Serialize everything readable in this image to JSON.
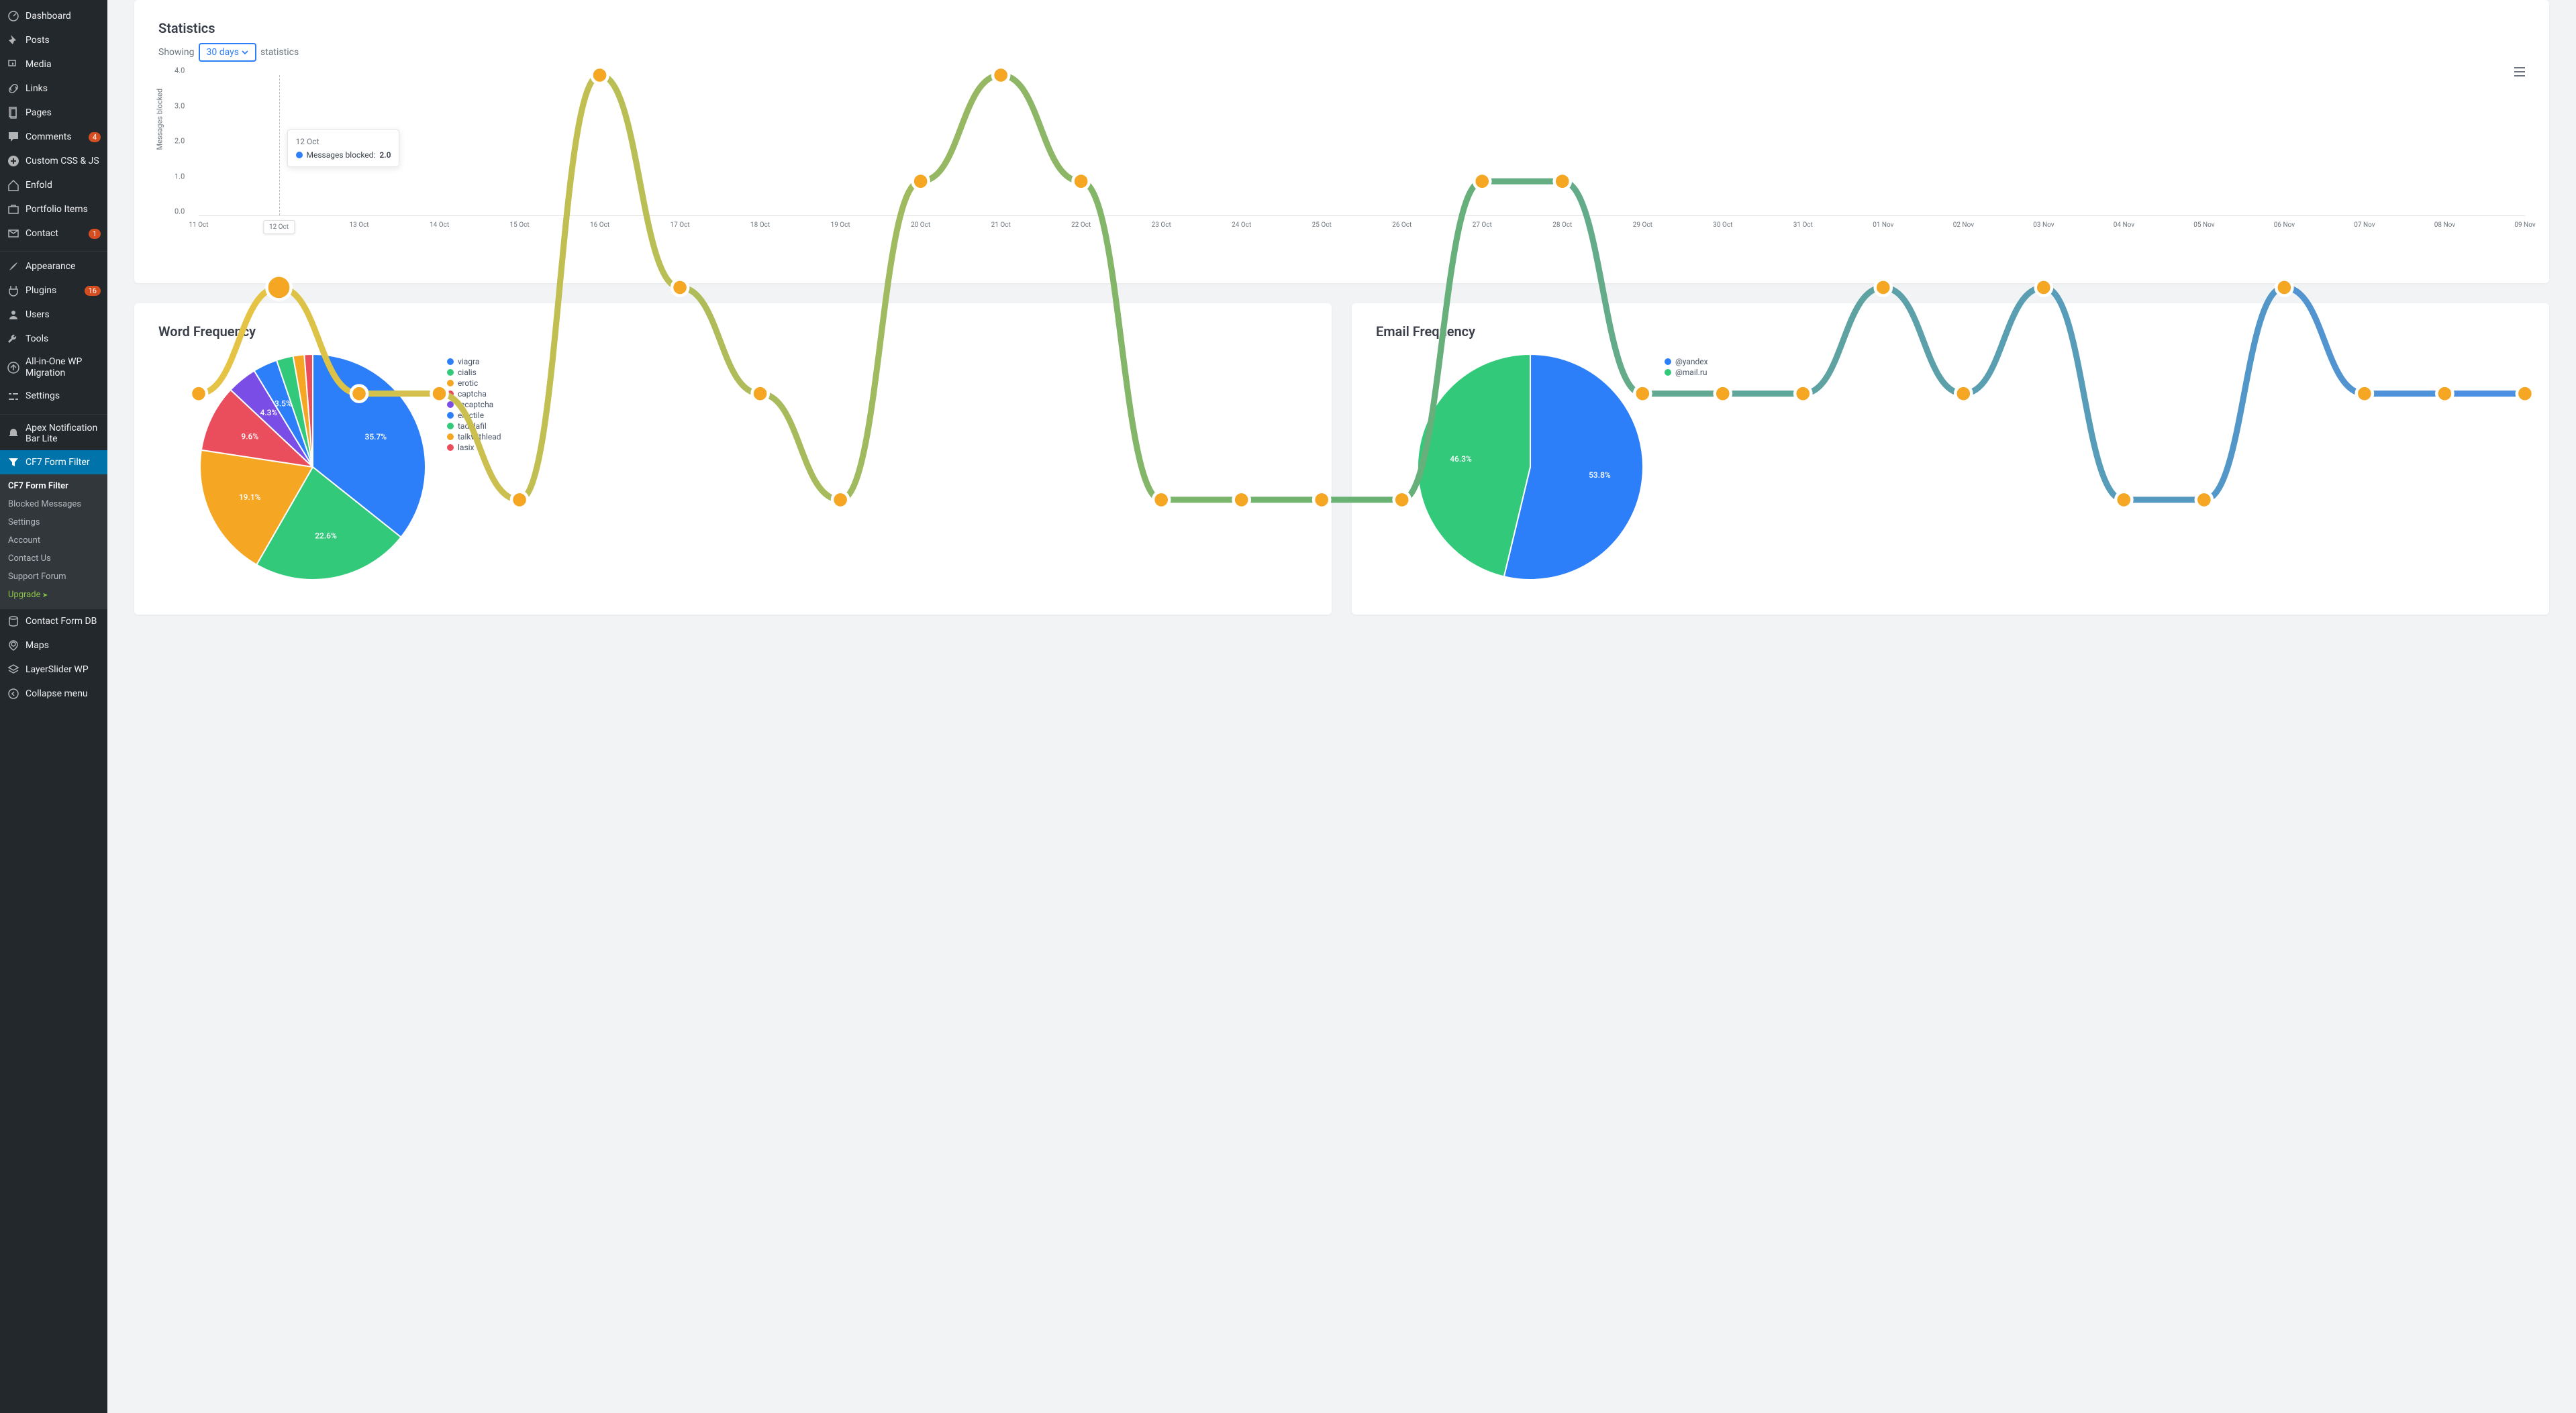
{
  "sidebar": {
    "items": [
      {
        "label": "Dashboard",
        "icon": "dashboard"
      },
      {
        "label": "Posts",
        "icon": "pin"
      },
      {
        "label": "Media",
        "icon": "media"
      },
      {
        "label": "Links",
        "icon": "link"
      },
      {
        "label": "Pages",
        "icon": "page"
      },
      {
        "label": "Comments",
        "icon": "comment",
        "badge": "4"
      },
      {
        "label": "Custom CSS & JS",
        "icon": "plus"
      },
      {
        "label": "Enfold",
        "icon": "home"
      },
      {
        "label": "Portfolio Items",
        "icon": "portfolio"
      },
      {
        "label": "Contact",
        "icon": "contact",
        "badge": "1"
      },
      {
        "sep": true
      },
      {
        "label": "Appearance",
        "icon": "brush"
      },
      {
        "label": "Plugins",
        "icon": "plugin",
        "badge": "16"
      },
      {
        "label": "Users",
        "icon": "user"
      },
      {
        "label": "Tools",
        "icon": "wrench"
      },
      {
        "label": "All-in-One WP Migration",
        "icon": "migrate"
      },
      {
        "label": "Settings",
        "icon": "settings"
      },
      {
        "sep": true
      },
      {
        "label": "Apex Notification Bar Lite",
        "icon": "bell"
      },
      {
        "label": "CF7 Form Filter",
        "icon": "filter",
        "active": true
      }
    ],
    "submenu": [
      {
        "label": "CF7 Form Filter",
        "current": true
      },
      {
        "label": "Blocked Messages"
      },
      {
        "label": "Settings"
      },
      {
        "label": "Account"
      },
      {
        "label": "Contact Us"
      },
      {
        "label": "Support Forum"
      },
      {
        "label": "Upgrade",
        "upgrade": true
      }
    ],
    "items2": [
      {
        "label": "Contact Form DB",
        "icon": "db"
      },
      {
        "label": "Maps",
        "icon": "map"
      },
      {
        "label": "LayerSlider WP",
        "icon": "layers"
      },
      {
        "label": "Collapse menu",
        "icon": "collapse"
      }
    ]
  },
  "stats": {
    "title": "Statistics",
    "showing_pre": "Showing",
    "period": "30 days",
    "showing_post": "statistics",
    "tooltip": {
      "date": "12 Oct",
      "series_label": "Messages blocked:",
      "value": "2.0"
    },
    "y_axis_label": "Messages blocked",
    "highlighted_x": "12 Oct"
  },
  "word_freq": {
    "title": "Word Frequency"
  },
  "email_freq": {
    "title": "Email Frequency"
  },
  "chart_data": [
    {
      "type": "line",
      "title": "Statistics",
      "ylabel": "Messages blocked",
      "ylim": [
        0,
        4
      ],
      "y_ticks": [
        0.0,
        1.0,
        2.0,
        3.0,
        4.0
      ],
      "categories": [
        "11 Oct",
        "12 Oct",
        "13 Oct",
        "14 Oct",
        "15 Oct",
        "16 Oct",
        "17 Oct",
        "18 Oct",
        "19 Oct",
        "20 Oct",
        "21 Oct",
        "22 Oct",
        "23 Oct",
        "24 Oct",
        "25 Oct",
        "26 Oct",
        "27 Oct",
        "28 Oct",
        "29 Oct",
        "30 Oct",
        "31 Oct",
        "01 Nov",
        "02 Nov",
        "03 Nov",
        "04 Nov",
        "05 Nov",
        "06 Nov",
        "07 Nov",
        "08 Nov",
        "09 Nov"
      ],
      "values": [
        1,
        2,
        1,
        1,
        0,
        4,
        2,
        1,
        0,
        3,
        4,
        3,
        0,
        0,
        0,
        0,
        3,
        3,
        1,
        1,
        1,
        2,
        1,
        2,
        0,
        0,
        2,
        1,
        1,
        1
      ],
      "highlight_index": 1,
      "tooltip_index": 1
    },
    {
      "type": "pie",
      "title": "Word Frequency",
      "series": [
        {
          "name": "viagra",
          "value": 35.7,
          "color": "#2d7ff9"
        },
        {
          "name": "cialis",
          "value": 22.6,
          "color": "#33c97a"
        },
        {
          "name": "erotic",
          "value": 19.1,
          "color": "#f5a623"
        },
        {
          "name": "captcha",
          "value": 9.6,
          "color": "#ea4e5d"
        },
        {
          "name": "recaptcha",
          "value": 4.3,
          "color": "#7a4de6"
        },
        {
          "name": "erectile",
          "value": 3.5,
          "color": "#2d7ff9"
        },
        {
          "name": "tadalafil",
          "value": 2.4,
          "color": "#33c97a"
        },
        {
          "name": "talkwithlead",
          "value": 1.6,
          "color": "#f5a623"
        },
        {
          "name": "lasix",
          "value": 1.2,
          "color": "#ea4e5d"
        }
      ],
      "labels_shown": [
        "35.7%",
        "22.6%",
        "19.1%",
        "9.6%",
        "4.3%",
        "3.5%"
      ]
    },
    {
      "type": "pie",
      "title": "Email Frequency",
      "series": [
        {
          "name": "@yandex",
          "value": 53.8,
          "color": "#2d7ff9"
        },
        {
          "name": "@mail.ru",
          "value": 46.3,
          "color": "#33c97a"
        }
      ],
      "labels_shown": [
        "53.8%",
        "46.3%"
      ]
    }
  ]
}
